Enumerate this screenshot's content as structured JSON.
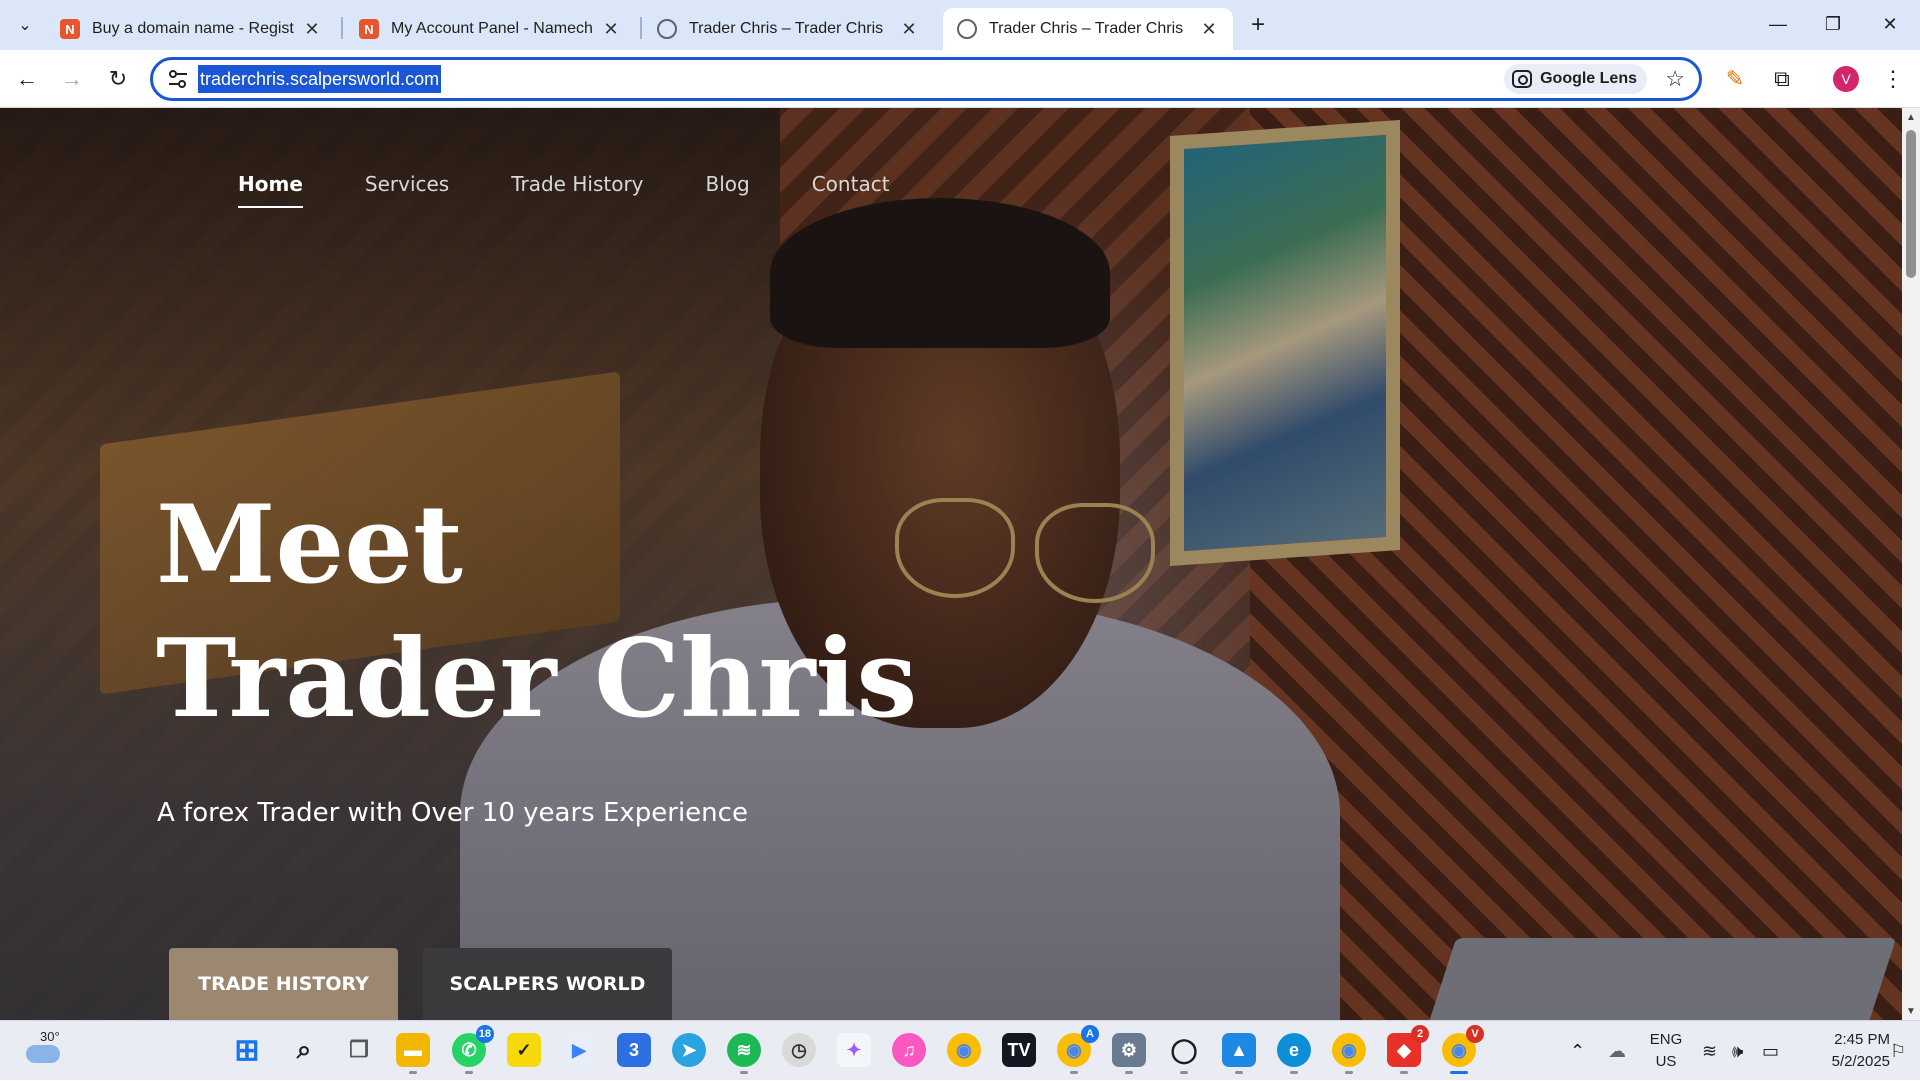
{
  "browser": {
    "tabs": [
      {
        "title": "Buy a domain name - Register c",
        "favicon": "namecheap-icon",
        "active": false
      },
      {
        "title": "My Account Panel - Namecheap",
        "favicon": "namecheap-icon",
        "active": false
      },
      {
        "title": "Trader Chris – Trader Chris",
        "favicon": "globe-icon",
        "active": false
      },
      {
        "title": "Trader Chris – Trader Chris",
        "favicon": "globe-icon",
        "active": true
      }
    ],
    "url": "traderchris.scalpersworld.com",
    "lens_label": "Google Lens",
    "profile_initial": "V",
    "accent": "#1a56d6"
  },
  "site": {
    "nav": [
      {
        "label": "Home",
        "active": true
      },
      {
        "label": "Services",
        "active": false
      },
      {
        "label": "Trade History",
        "active": false
      },
      {
        "label": "Blog",
        "active": false
      },
      {
        "label": "Contact",
        "active": false
      }
    ],
    "hero": {
      "title_line1": "Meet",
      "title_line2": "Trader Chris",
      "subtitle": "A forex Trader with Over 10 years Experience",
      "cta_primary": "TRADE HISTORY",
      "cta_secondary": "SCALPERS WORLD"
    },
    "colors": {
      "cta_primary": "#9c8770",
      "cta_secondary": "#3b3a3c"
    }
  },
  "taskbar": {
    "weather_temp": "30°",
    "whatsapp_badge": "18",
    "chrome_a_badge": "A",
    "anydesk_badge": "2",
    "chrome_profile_badge": "V",
    "lang_line1": "ENG",
    "lang_line2": "US",
    "time": "2:45 PM",
    "date": "5/2/2025"
  }
}
